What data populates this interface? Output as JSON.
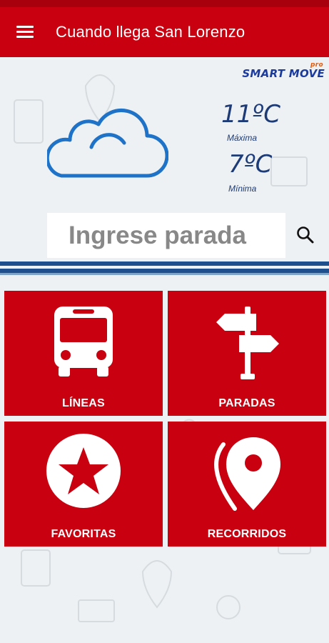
{
  "app": {
    "title": "Cuando llega San Lorenzo",
    "brand": "SMART MOVE",
    "brand_badge": "pro"
  },
  "weather": {
    "icon": "cloud-icon",
    "max_temp": "11ºC",
    "max_label": "Máxima",
    "min_temp": "7ºC",
    "min_label": "Mínima"
  },
  "search": {
    "placeholder": "Ingrese parada",
    "icon": "search-icon"
  },
  "tiles": [
    {
      "label": "LÍNEAS",
      "icon": "bus-icon"
    },
    {
      "label": "PARADAS",
      "icon": "signpost-icon"
    },
    {
      "label": "FAVORITAS",
      "icon": "star-icon"
    },
    {
      "label": "RECORRIDOS",
      "icon": "map-pin-icon"
    }
  ],
  "colors": {
    "primary": "#c8000f",
    "status_bar": "#a9000d",
    "stripe": "#1f4f8c",
    "temperature_text": "#1c3b77",
    "cloud_stroke": "#1e73c8"
  }
}
